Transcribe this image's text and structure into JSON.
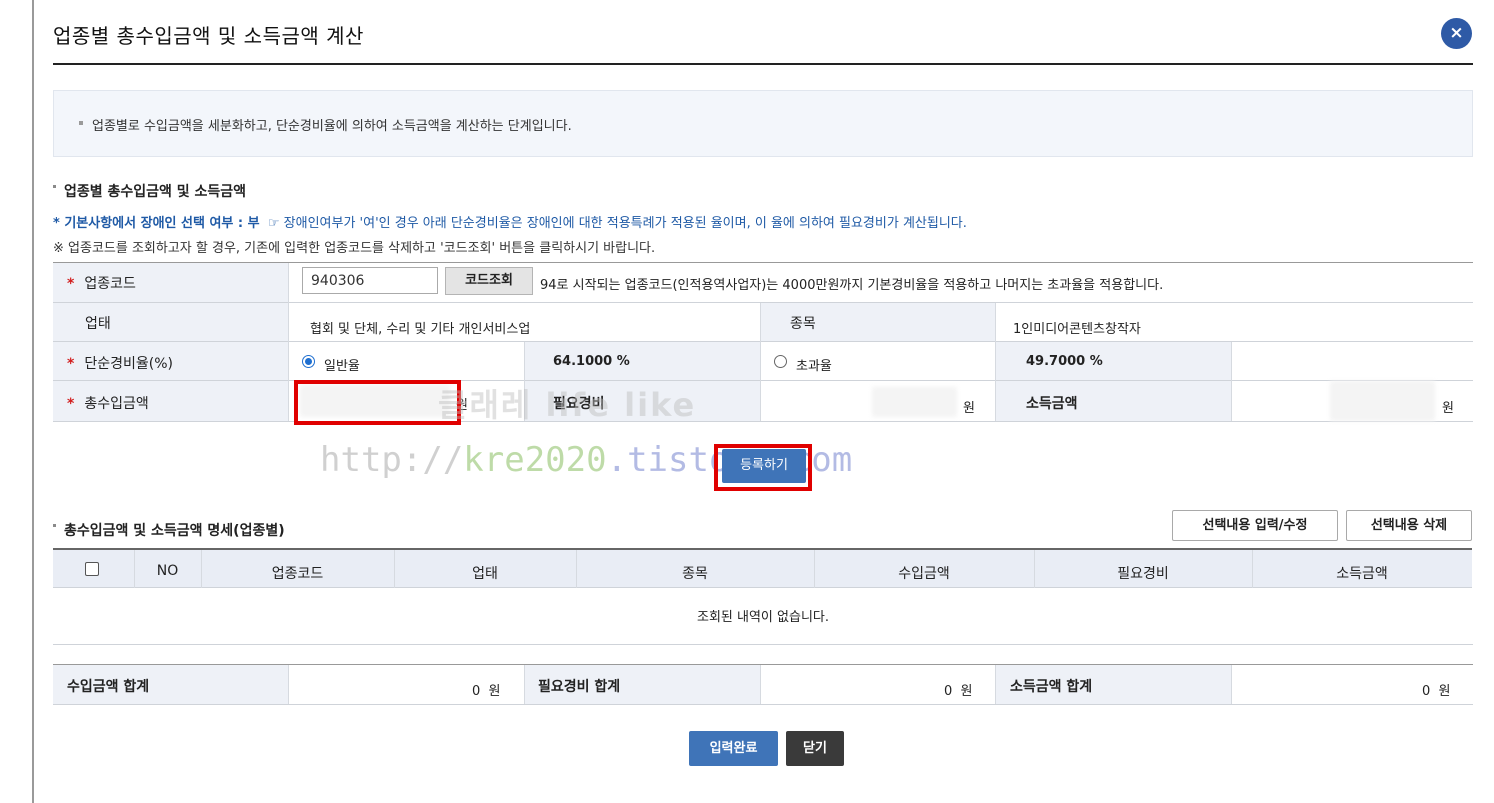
{
  "dialog": {
    "title": "업종별 총수입금액 및 소득금액 계산",
    "close_label": "×",
    "intro": "업종별로 수입금액을 세분화하고, 단순경비율에 의하여 소득금액을 계산하는 단계입니다."
  },
  "section1": {
    "title": "업종별 총수입금액 및 소득금액",
    "note_disabled_label": "* 기본사항에서 장애인 선택 여부 : 부",
    "note_disabled_text": "☞ 장애인여부가 '여'인 경우 아래 단순경비율은 장애인에 대한 적용특례가 적용된 율이며, 이 율에 의하여 필요경비가 계산됩니다.",
    "note_code": "※ 업종코드를 조회하고자 할 경우, 기존에 입력한 업종코드를 삭제하고 '코드조회' 버튼을 클릭하시기 바랍니다."
  },
  "form": {
    "required_mark": "*",
    "code_label": "업종코드",
    "code_value": "940306",
    "code_button": "코드조회",
    "code_hint": "94로 시작되는 업종코드(인적용역사업자)는 4000만원까지 기본경비율을 적용하고 나머지는 초과율을 적용합니다.",
    "business_label": "업태",
    "business_value": "협회 및 단체, 수리 및 기타 개인서비스업",
    "item_label": "종목",
    "item_value": "1인미디어콘텐츠창작자",
    "rate_label": "단순경비율(%)",
    "rate_general_label": "일반율",
    "rate_general_value": "64.1000 %",
    "rate_excess_label": "초과율",
    "rate_excess_value": "49.7000 %",
    "income_label": "총수입금액",
    "expense_label": "필요경비",
    "profit_label": "소득금액",
    "won": "원",
    "register_button": "등록하기"
  },
  "watermark": {
    "line1": "클래레 life like",
    "url_part1": "http://",
    "url_part2": "kre2020",
    "url_part3": ".tistory.com"
  },
  "section2": {
    "title": "총수입금액 및 소득금액 명세(업종별)",
    "btn_edit": "선택내용 입력/수정",
    "btn_delete": "선택내용 삭제",
    "columns": [
      "NO",
      "업종코드",
      "업태",
      "종목",
      "수입금액",
      "필요경비",
      "소득금액"
    ],
    "empty_message": "조회된 내역이 없습니다."
  },
  "totals": {
    "income_label": "수입금액 합계",
    "income_value": "0",
    "expense_label": "필요경비 합계",
    "expense_value": "0",
    "profit_label": "소득금액 합계",
    "profit_value": "0",
    "unit": "원"
  },
  "footer": {
    "complete_button": "입력완료",
    "close_button": "닫기"
  },
  "colors": {
    "primary_blue": "#3f74b8",
    "close_blue": "#2e5aa6",
    "header_bg": "#eef1f7",
    "highlight_red": "#e00000",
    "note_blue": "#1f5aa6",
    "dark_button": "#3a3a3a"
  }
}
